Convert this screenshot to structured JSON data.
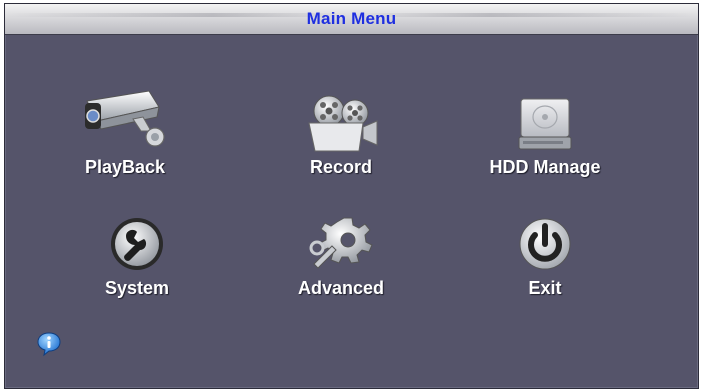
{
  "window": {
    "title": "Main Menu"
  },
  "menu": {
    "items": [
      {
        "label": "PlayBack",
        "icon": "security-camera-icon"
      },
      {
        "label": "Record",
        "icon": "film-reel-icon"
      },
      {
        "label": "HDD Manage",
        "icon": "hard-drive-icon"
      },
      {
        "label": "System",
        "icon": "wrench-icon"
      },
      {
        "label": "Advanced",
        "icon": "gears-icon"
      },
      {
        "label": "Exit",
        "icon": "power-icon"
      }
    ]
  },
  "colors": {
    "background": "#55546a",
    "title_text": "#1f2fe0",
    "label_text": "#ffffff"
  },
  "status": {
    "icon": "info-icon"
  }
}
